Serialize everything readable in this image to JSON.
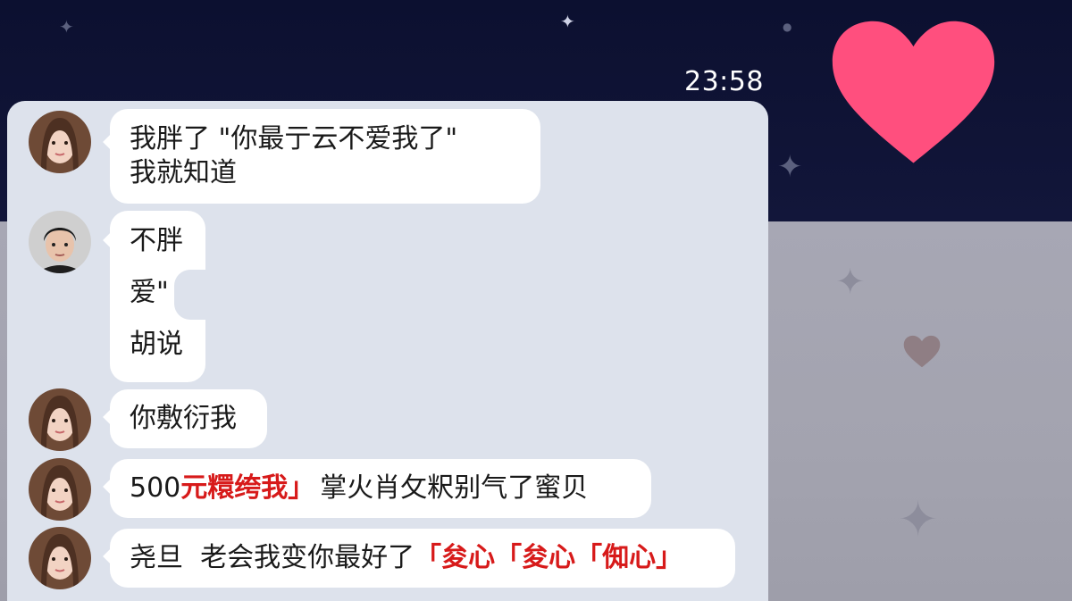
{
  "status": {
    "time": "23:58"
  },
  "background": {
    "icons": [
      "sparkle-icon",
      "heart-icon"
    ],
    "heart_color": "#ff4f7e"
  },
  "chat": {
    "messages": [
      {
        "sender": "female",
        "lines": [
          "我胖了 \"你最亍云不爱我了\"",
          "我就知道"
        ]
      },
      {
        "sender": "male",
        "lines": [
          "不胖",
          "爱\"",
          "胡说"
        ]
      },
      {
        "sender": "female",
        "lines": [
          "你敷衍我"
        ]
      },
      {
        "sender": "female",
        "segments": [
          {
            "text": "500",
            "style": "normal"
          },
          {
            "text": "元糫绔我」",
            "style": "red"
          },
          {
            "text": "掌火肖攵粎别气了蜜贝",
            "style": "normal"
          }
        ]
      },
      {
        "sender": "female",
        "segments": [
          {
            "text": "尧旦  老会我变你最好了",
            "style": "normal"
          },
          {
            "text": "「夋心「夋心「倁心」",
            "style": "red"
          }
        ]
      }
    ]
  }
}
